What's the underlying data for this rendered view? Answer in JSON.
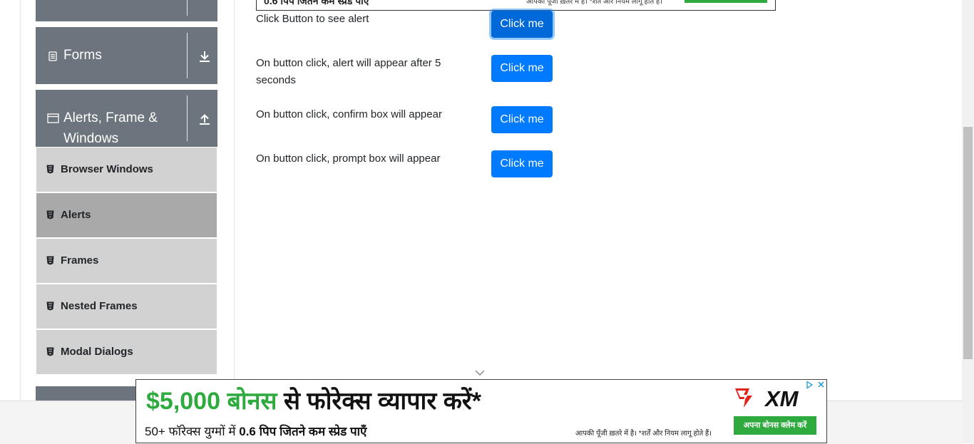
{
  "sidebar": {
    "groups": [
      {
        "title": ""
      },
      {
        "title": "Forms"
      },
      {
        "title": "Alerts, Frame & Windows"
      },
      {
        "title": ""
      }
    ],
    "items": [
      {
        "label": "Browser Windows"
      },
      {
        "label": "Alerts"
      },
      {
        "label": "Frames"
      },
      {
        "label": "Nested Frames"
      },
      {
        "label": "Modal Dialogs"
      }
    ]
  },
  "top_ad": {
    "left_text": "0.6 पिप जितने कम स्प्रेड पाएँ",
    "right_text": "आपकी पूँजी ख़तरे में है। *शर्तें और नियम लागू होते हैं।"
  },
  "main": {
    "rows": [
      {
        "label": "Click Button to see alert",
        "button": "Click me"
      },
      {
        "label": "On button click, alert will appear after 5 seconds",
        "button": "Click me"
      },
      {
        "label": "On button click, confirm box will appear",
        "button": "Click me"
      },
      {
        "label": "On button click, prompt box will appear",
        "button": "Click me"
      }
    ]
  },
  "ad": {
    "headline_amount": "$5,000 बोनस",
    "headline_rest": " से फोरेक्स व्यापार करें*",
    "sub_prefix": "50+ फॉरेक्स युग्मों में ",
    "sub_bold": "0.6 पिप जितने कम स्प्रेड पाएँ",
    "disclaimer": "आपकी पूँजी ख़तरे में है। *शर्तें और नियम लागू होते हैं।",
    "cta": "अपना बोनस क्लेम करें",
    "brand": "XM",
    "colors": {
      "green": "#2eaa3f",
      "brand_red": "#e1251b"
    }
  },
  "colors": {
    "primary": "#007bff",
    "sidebar_header": "#6c757d",
    "menu_item": "#d2d2d2",
    "menu_item_active": "#a9a9a9"
  }
}
